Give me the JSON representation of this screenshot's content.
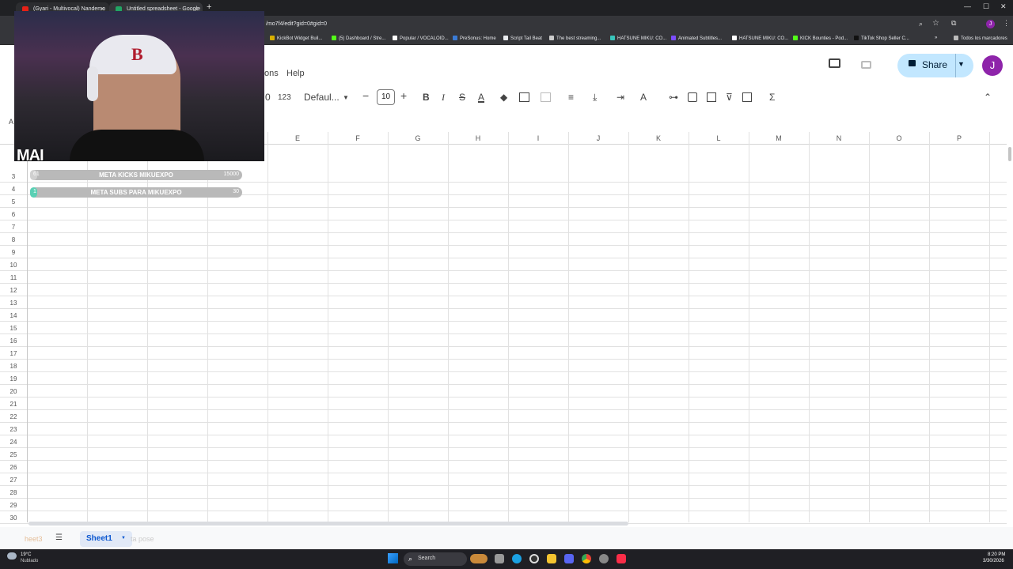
{
  "browser": {
    "tabs": [
      {
        "title": "(Gyari - Multivocal) Nandemo"
      },
      {
        "title": "Untitled spreadsheet - Google"
      }
    ],
    "new_tab": "+",
    "url": "/mo7f4/edit?gid=0#gid=0",
    "bookmarks": [
      "KickBot Widget Buil...",
      "(5) Dashboard / Stre...",
      "Popular / VOCALOID...",
      "PreSonus: Home",
      "Script Tail Beat",
      "The best streaming...",
      "HATSUNE MIKU: CO...",
      "Animated Subtitles...",
      "HATSUNE MIKU: CO...",
      "KICK Bounties - Pod...",
      "TikTok Shop Seller C..."
    ],
    "bookmarks_folder": "Todos los marcadores",
    "profile_initial": "J"
  },
  "sheets": {
    "menu_fragment": "ons",
    "menu_help": "Help",
    "share_label": "Share",
    "avatar_initial": "J",
    "toolbar": {
      "format_123": "123",
      "font_name": "Defaul...",
      "font_size": "10",
      "minus": "−",
      "plus": "+",
      "bold": "B",
      "italic": "I",
      "strike": "S",
      "text_color": "A",
      "sum": "Σ",
      "zoom_fragment": "0"
    },
    "name_box_fragment": "A",
    "columns": [
      "E",
      "F",
      "G",
      "H",
      "I",
      "J",
      "K",
      "L",
      "M",
      "N",
      "O",
      "P"
    ],
    "rows": [
      "3",
      "4",
      "5",
      "6",
      "7",
      "8",
      "9",
      "10",
      "11",
      "12",
      "13",
      "14",
      "15",
      "16",
      "17",
      "18",
      "19",
      "20",
      "21",
      "22",
      "23",
      "24",
      "25",
      "26",
      "27",
      "28",
      "29",
      "30"
    ],
    "sheet_tab": "Sheet1",
    "sheet_tab_faded_left": "heet3",
    "sheet_tab_faded_right": "ta pose"
  },
  "overlay": {
    "webcam_caption": "MAI",
    "bars": [
      {
        "label": "META KICKS MIKUEXPO",
        "current": "61",
        "goal": "15000",
        "progress": 0.004
      },
      {
        "label": "META SUBS PARA MIKUEXPO",
        "current": "1",
        "goal": "30",
        "progress": 0.033
      }
    ]
  },
  "taskbar": {
    "weather_temp": "19°C",
    "weather_desc": "Nublado",
    "search_label": "Search",
    "time": "8:20 PM",
    "date": "3/30/2026"
  },
  "colors": {
    "share_bg": "#c2e7ff",
    "avatar": "#8e24aa",
    "subs_fill": "#5ad0b4"
  }
}
